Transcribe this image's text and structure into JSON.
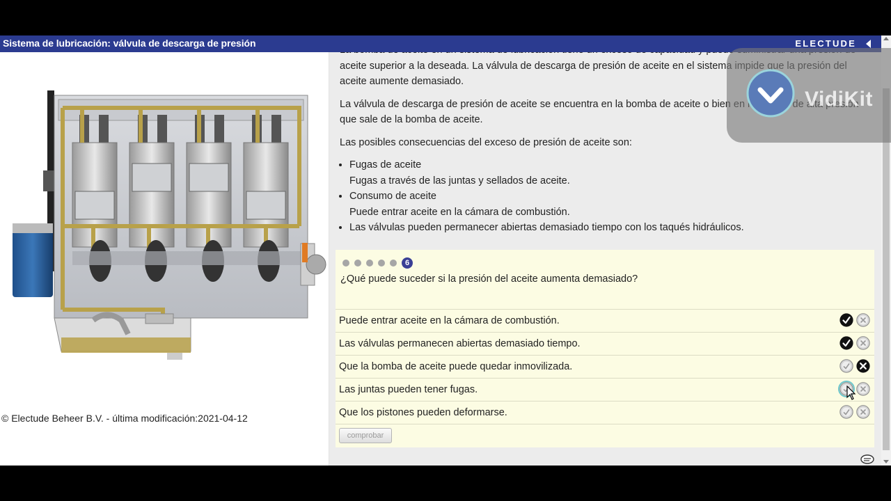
{
  "header": {
    "title": "Sistema de lubricación: válvula de descarga de presión",
    "brand": "ELECTUDE"
  },
  "footer": {
    "copyright": "© Electude Beheer B.V. - última modificación:2021-04-12"
  },
  "content": {
    "paragraph_cut": "La bomba de aceite en un sistema de lubricación tiene un exceso de capacidad y puede suministrar una presión de aceite superior a la deseada. La válvula de descarga de presión de aceite en el sistema impide que la presión del aceite aumente demasiado.",
    "paragraph_2": "La válvula de descarga de presión de aceite se encuentra en la bomba de aceite o bien en la tubería de alta presión que sale de la bomba de aceite.",
    "paragraph_3": "Las posibles consecuencias del exceso de presión de aceite son:",
    "bullets": [
      {
        "title": "Fugas de aceite",
        "detail": "Fugas a través de las juntas y sellados de aceite."
      },
      {
        "title": "Consumo de aceite",
        "detail": "Puede entrar aceite en la cámara de combustión."
      },
      {
        "title": "Las válvulas pueden permanecer abiertas demasiado tiempo con los taqués hidráulicos.",
        "detail": ""
      }
    ]
  },
  "quiz": {
    "current_step": "6",
    "question": "¿Qué puede suceder si la presión del aceite aumenta demasiado?",
    "answers": [
      {
        "text": "Puede entrar aceite en la cámara de combustión.",
        "state": "true"
      },
      {
        "text": "Las válvulas permanecen abiertas demasiado tiempo.",
        "state": "true"
      },
      {
        "text": "Que la bomba de aceite puede quedar inmovilizada.",
        "state": "false"
      },
      {
        "text": "Las juntas pueden tener fugas.",
        "state": "none"
      },
      {
        "text": "Que los pistones pueden deformarse.",
        "state": "none"
      }
    ],
    "check_label": "comprobar"
  },
  "watermark": {
    "label": "VidiKit"
  },
  "colors": {
    "titlebar": "#2b3b90",
    "quiz_bg": "#fcfce3",
    "oil": "#b8a14a",
    "accent": "#3a3f95"
  }
}
